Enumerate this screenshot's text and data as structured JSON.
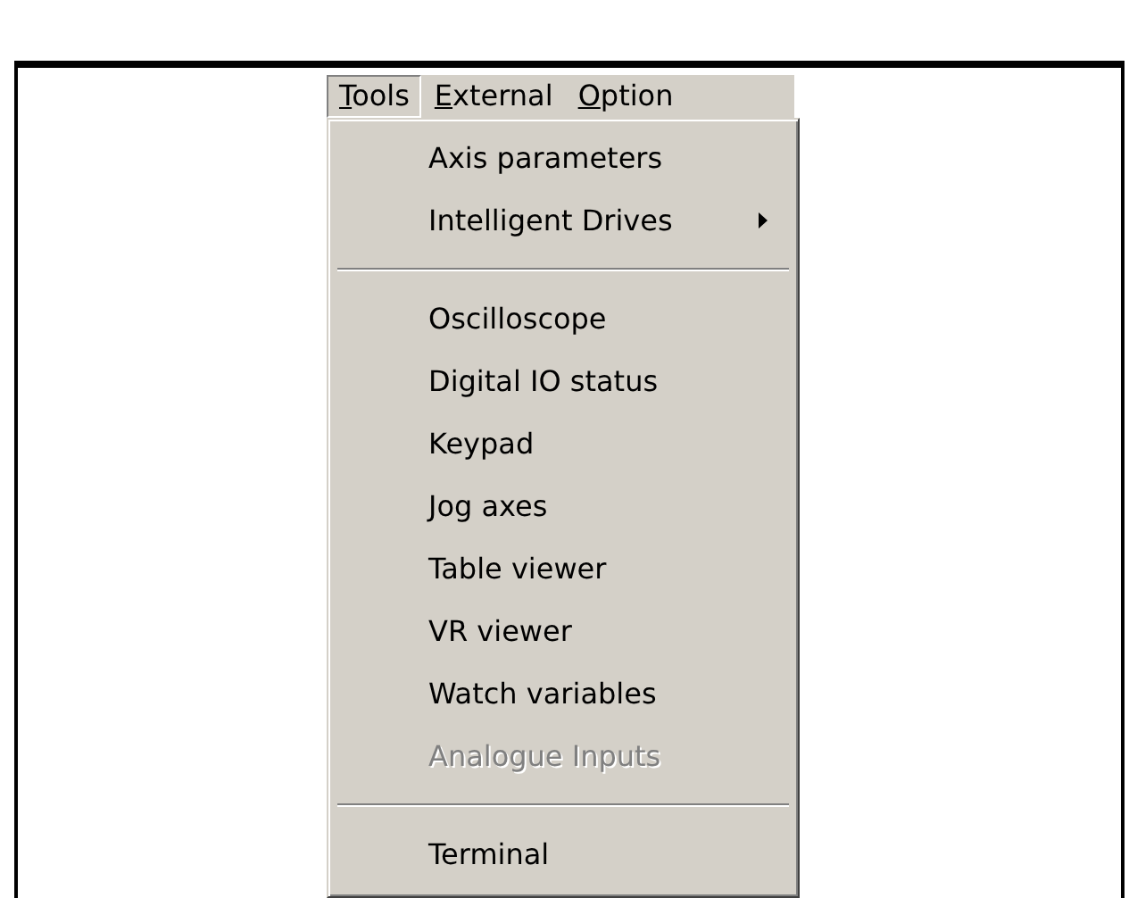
{
  "menu_bar": [
    {
      "access_key": "T",
      "label_rest": "ools",
      "selected": true
    },
    {
      "access_key": "E",
      "label_rest": "xternal",
      "selected": false
    },
    {
      "access_key": "O",
      "label_rest": "ption",
      "selected": false
    }
  ],
  "menu": {
    "items": [
      {
        "kind": "item",
        "label": "Axis parameters",
        "disabled": false
      },
      {
        "kind": "submenu",
        "label": "Intelligent Drives",
        "disabled": false
      },
      {
        "kind": "separator"
      },
      {
        "kind": "item",
        "label": "Oscilloscope",
        "disabled": false
      },
      {
        "kind": "item",
        "label": "Digital IO status",
        "disabled": false
      },
      {
        "kind": "item",
        "label": "Keypad",
        "disabled": false
      },
      {
        "kind": "item",
        "label": "Jog axes",
        "disabled": false
      },
      {
        "kind": "item",
        "label": "Table viewer",
        "disabled": false
      },
      {
        "kind": "item",
        "label": "VR viewer",
        "disabled": false
      },
      {
        "kind": "item",
        "label": "Watch variables",
        "disabled": false
      },
      {
        "kind": "item",
        "label": "Analogue Inputs",
        "disabled": true
      },
      {
        "kind": "separator"
      },
      {
        "kind": "item",
        "label": "Terminal",
        "disabled": false
      }
    ]
  }
}
